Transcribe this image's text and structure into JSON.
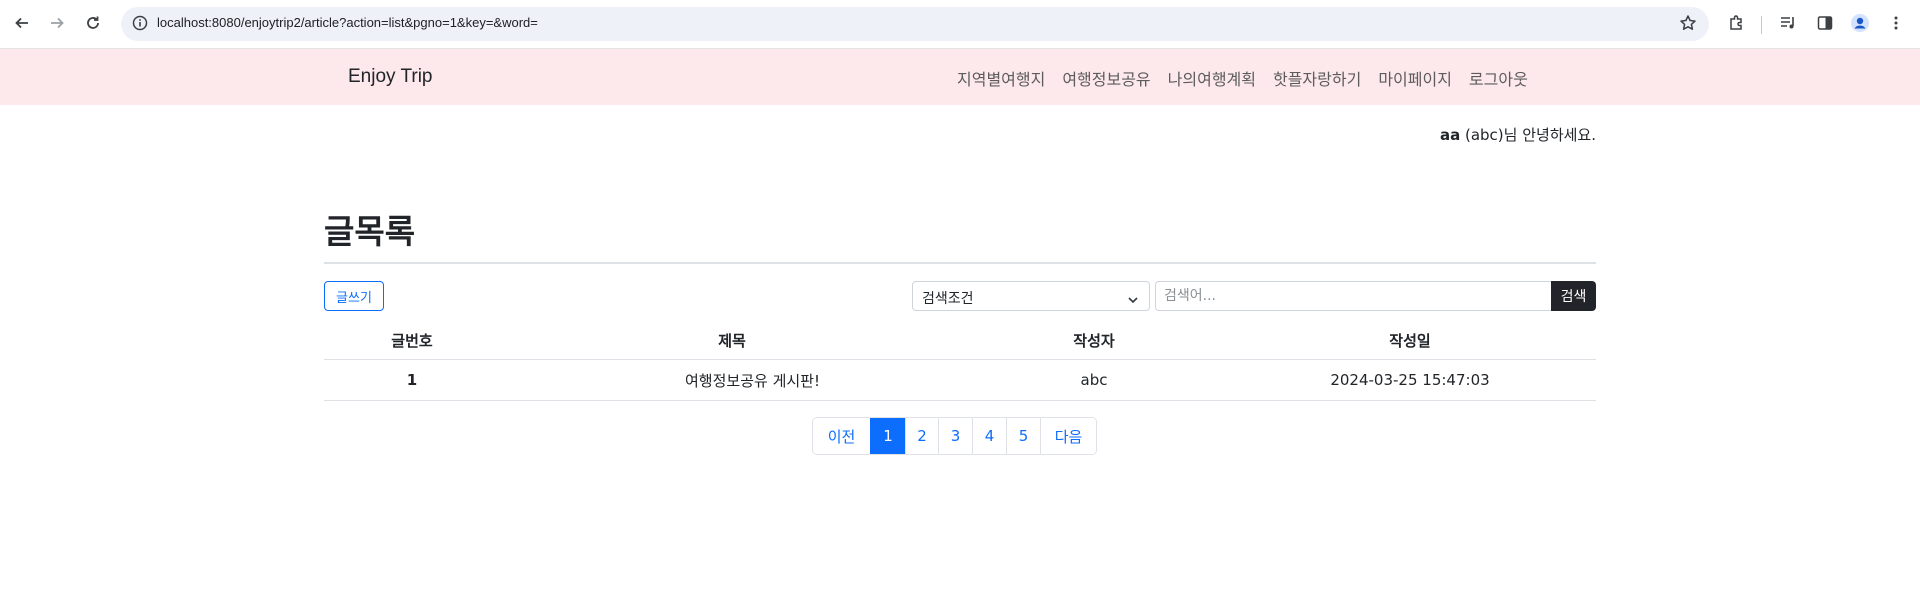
{
  "browser": {
    "url": "localhost:8080/enjoytrip2/article?action=list&pgno=1&key=&word=",
    "icons": [
      "back-icon",
      "forward-icon",
      "reload-icon",
      "info-icon",
      "star-icon",
      "extensions-icon",
      "media-icon",
      "side-panel-icon",
      "profile-icon",
      "menu-icon"
    ]
  },
  "navbar": {
    "brand": "Enjoy Trip",
    "links": [
      "지역별여행지",
      "여행정보공유",
      "나의여행계획",
      "핫플자랑하기",
      "마이페이지",
      "로그아웃"
    ]
  },
  "greeting": {
    "user": "aa",
    "rest": " (abc)님 안녕하세요."
  },
  "page": {
    "title": "글목록",
    "write_label": "글쓰기"
  },
  "search": {
    "select_value": "검색조건",
    "placeholder": "검색어...",
    "button_label": "검색"
  },
  "table": {
    "headers": [
      "글번호",
      "제목",
      "작성자",
      "작성일"
    ],
    "rows": [
      {
        "no": "1",
        "title": "여행정보공유 게시판!",
        "author": "abc",
        "date": "2024-03-25 15:47:03"
      }
    ]
  },
  "pagination": {
    "items": [
      "이전",
      "1",
      "2",
      "3",
      "4",
      "5",
      "다음"
    ],
    "active": "1"
  },
  "colors": {
    "navbar_bg": "#fde8ec",
    "primary": "#0d6efd",
    "dark_button": "#212529"
  }
}
